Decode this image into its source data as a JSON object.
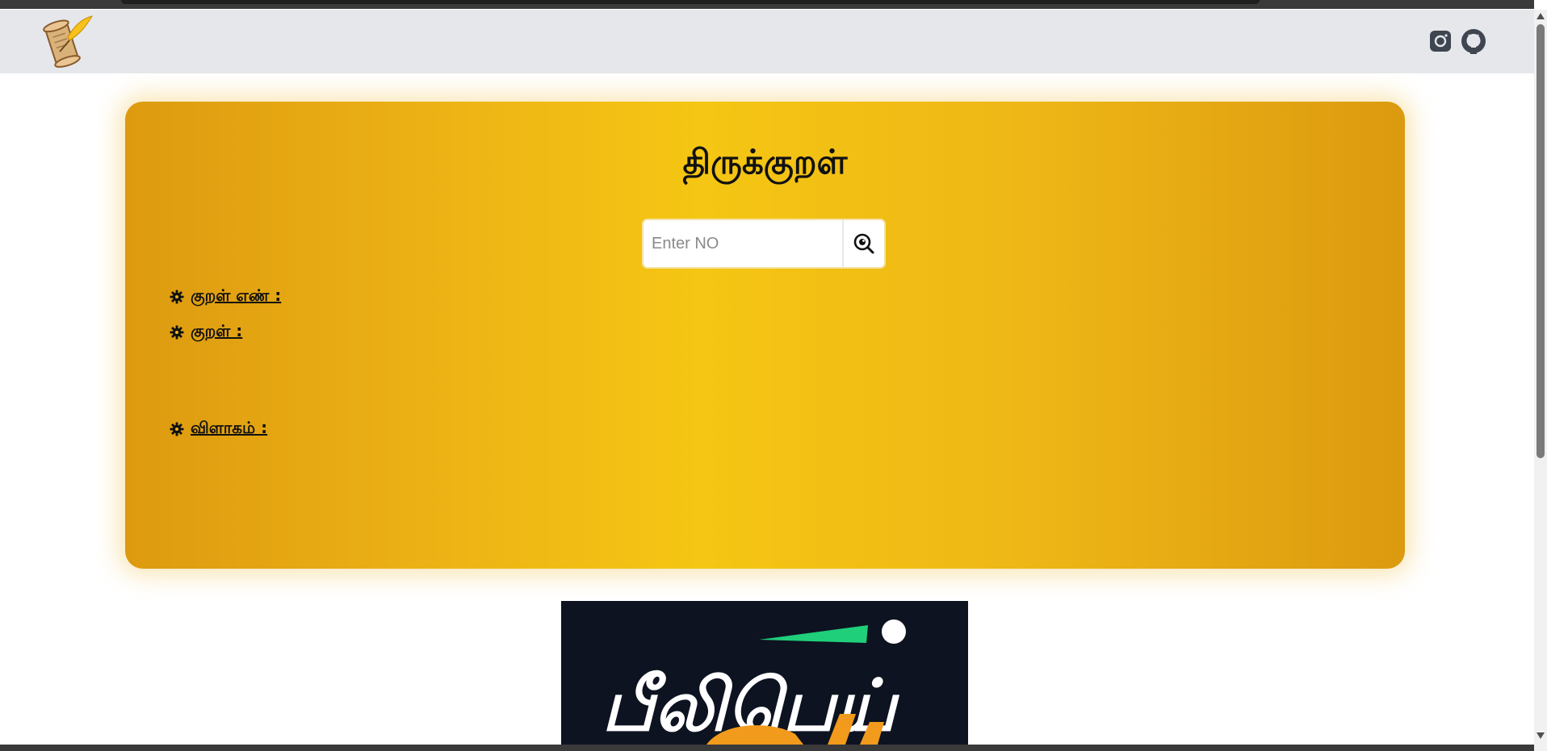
{
  "navbar": {
    "logo_icon": "scroll-quill-icon",
    "social": [
      {
        "icon": "instagram-icon"
      },
      {
        "icon": "github-icon"
      }
    ]
  },
  "main": {
    "title": "திருக்குறள்",
    "search": {
      "placeholder": "Enter NO",
      "value": "",
      "button_icon": "search-eye-icon"
    },
    "fields": [
      {
        "icon": "gear-icon",
        "label": "குறள் எண் :"
      },
      {
        "icon": "gear-icon",
        "label": "குறள் :"
      },
      {
        "icon": "gear-icon",
        "label": "விளாகம் :"
      }
    ]
  },
  "banner": {
    "text": "பீலிபெய்"
  },
  "colors": {
    "navbar_bg": "#e5e7eb",
    "card_gold": "#f5c613",
    "card_edge": "#dd9a10",
    "banner_bg": "#0d1320",
    "banner_accent_green": "#1fcf7a",
    "banner_accent_orange": "#f29a1c"
  }
}
